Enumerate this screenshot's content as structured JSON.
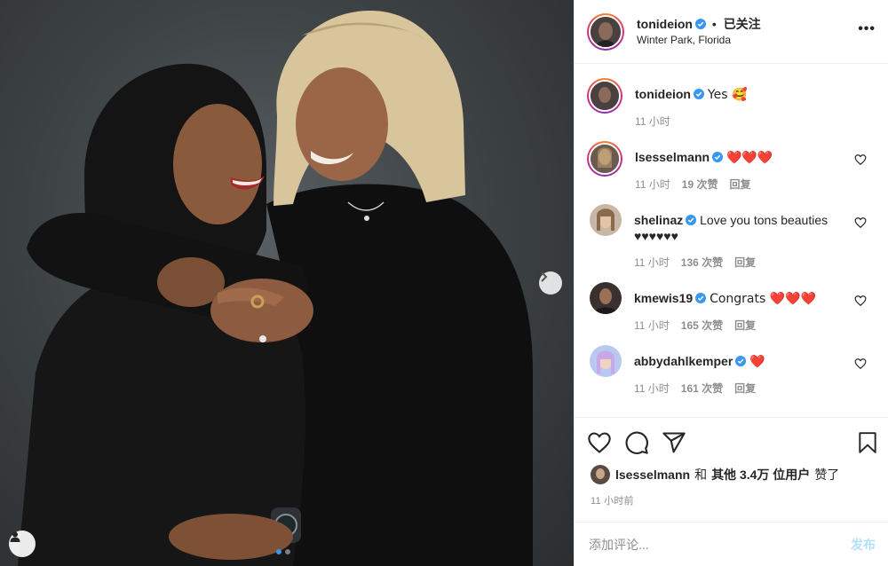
{
  "header": {
    "username": "tonideion",
    "separator": "•",
    "follow_state": "已关注",
    "location": "Winter Park, Florida",
    "more": "•••"
  },
  "caption": {
    "username": "tonideion",
    "text": "Yes 🥰",
    "time": "11 小时"
  },
  "comments": [
    {
      "username": "lsesselmann",
      "text": "❤️❤️❤️",
      "time": "11 小时",
      "likes": "19 次赞",
      "reply": "回复"
    },
    {
      "username": "shelinaz",
      "text": "Love you tons beauties ♥♥♥♥♥♥",
      "time": "11 小时",
      "likes": "136 次赞",
      "reply": "回复"
    },
    {
      "username": "kmewis19",
      "text": "Congrats ❤️❤️❤️",
      "time": "11 小时",
      "likes": "165 次赞",
      "reply": "回复"
    },
    {
      "username": "abbydahlkemper",
      "text": "❤️",
      "time": "11 小时",
      "likes": "161 次赞",
      "reply": "回复"
    }
  ],
  "liked_by": {
    "user": "lsesselmann",
    "and": "和",
    "others": "其他 3.4万 位用户",
    "suffix": "赞了"
  },
  "post_time": "11 小时前",
  "composer": {
    "placeholder": "添加评论...",
    "post_label": "发布"
  },
  "carousel": {
    "slide_count": 2,
    "active_index": 0
  },
  "colors": {
    "verified": "#3897f0",
    "post_button": "#b2dffc",
    "muted": "#8e8e8e",
    "heart": "#ed4956"
  },
  "icons": [
    "verified-icon",
    "more-icon",
    "heart-icon",
    "comment-icon",
    "share-icon",
    "bookmark-icon",
    "next-arrow-icon",
    "user-tag-icon"
  ]
}
